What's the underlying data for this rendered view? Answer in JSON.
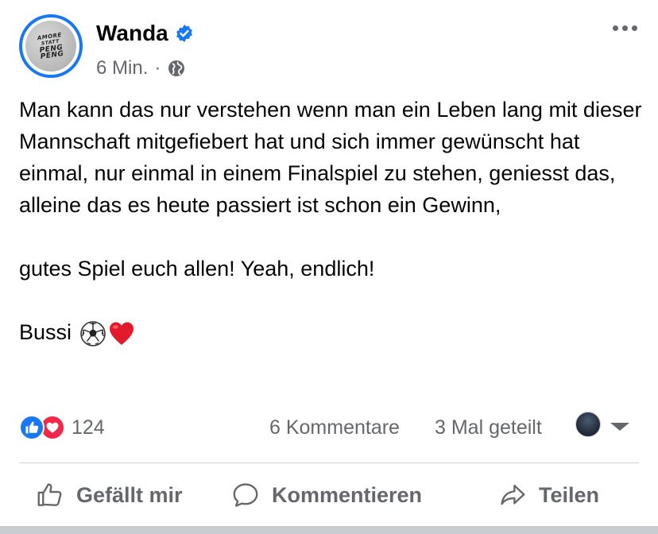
{
  "post": {
    "author": "Wanda",
    "avatar_text": [
      "AMORE",
      "STATT",
      "PENG",
      "PENG"
    ],
    "time": "6 Min.",
    "separator": "·",
    "paragraphs": [
      "Man kann das nur verstehen wenn man ein Leben lang mit dieser Mannschaft mitgefiebert hat und sich immer gewünscht hat einmal, nur einmal in einem Finalspiel zu stehen, geniesst das, alleine das es heute passiert ist schon ein Gewinn,",
      "gutes Spiel euch allen! Yeah, endlich!",
      "Bussi"
    ]
  },
  "stats": {
    "reaction_count": "124",
    "comments": "6 Kommentare",
    "shares": "3 Mal geteilt"
  },
  "actions": {
    "like": "Gefällt mir",
    "comment": "Kommentieren",
    "share": "Teilen"
  },
  "icons": {
    "verified": "verified-badge-icon",
    "audience": "globe-icon",
    "more": "more-options-icon",
    "like": "thumbs-up-icon",
    "comment": "speech-bubble-icon",
    "share": "share-arrow-icon",
    "emoji_1": "soccer-ball",
    "emoji_2": "red-heart"
  },
  "colors": {
    "accent": "#1877f2",
    "love": "#f0284a",
    "secondary_text": "#65676b",
    "divider": "#ced0d4"
  }
}
